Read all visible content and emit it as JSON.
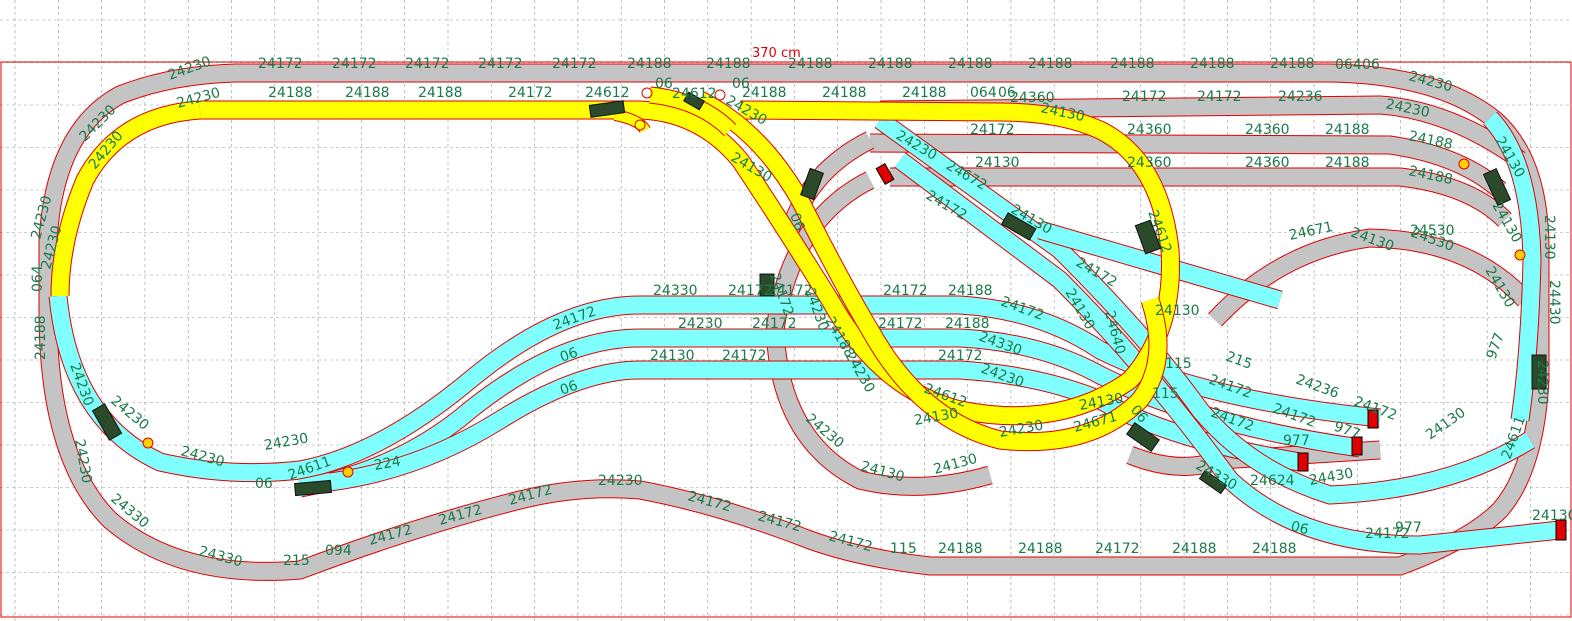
{
  "layout": {
    "board_width_label": "370 cm",
    "colors": {
      "grey_track": "#c4c4c4",
      "cyan_track": "#80ffff",
      "yellow_track": "#ffff00",
      "rail_edge": "#e00000",
      "label": "#1a7a4a",
      "grid": "#9a9a9a",
      "switch_motor": "#2a4a2a"
    },
    "track_labels": [
      {
        "text": "24230",
        "icon": "track-piece"
      },
      {
        "text": "24172"
      },
      {
        "text": "24172"
      },
      {
        "text": "24172"
      },
      {
        "text": "24172"
      },
      {
        "text": "24172"
      },
      {
        "text": "24188"
      },
      {
        "text": "24188"
      },
      {
        "text": "24188"
      },
      {
        "text": "24188"
      },
      {
        "text": "24188"
      },
      {
        "text": "24188"
      },
      {
        "text": "24188"
      },
      {
        "text": "24188"
      },
      {
        "text": "24188"
      },
      {
        "text": "064"
      },
      {
        "text": "06"
      },
      {
        "text": "24230"
      },
      {
        "text": "24230"
      },
      {
        "text": "24188"
      },
      {
        "text": "24188"
      },
      {
        "text": "24188"
      },
      {
        "text": "24172"
      },
      {
        "text": "24612"
      },
      {
        "text": "06"
      },
      {
        "text": "24612"
      },
      {
        "text": "06"
      },
      {
        "text": "24188"
      },
      {
        "text": "24188"
      },
      {
        "text": "24188"
      },
      {
        "text": "064"
      },
      {
        "text": "06"
      },
      {
        "text": "24360"
      },
      {
        "text": "24130"
      },
      {
        "text": "24172"
      },
      {
        "text": "24172"
      },
      {
        "text": "24236"
      },
      {
        "text": "24230"
      },
      {
        "text": "24230"
      },
      {
        "text": "24230"
      },
      {
        "text": "24230"
      },
      {
        "text": "24230"
      },
      {
        "text": "064"
      },
      {
        "text": "24188"
      },
      {
        "text": "24230"
      },
      {
        "text": "24230"
      },
      {
        "text": "24130"
      },
      {
        "text": "24230"
      },
      {
        "text": "24172"
      },
      {
        "text": "24360"
      },
      {
        "text": "24360"
      },
      {
        "text": "24188"
      },
      {
        "text": "24188"
      },
      {
        "text": "24130"
      },
      {
        "text": "24360"
      },
      {
        "text": "24360"
      },
      {
        "text": "24188"
      },
      {
        "text": "24188"
      },
      {
        "text": "24130"
      },
      {
        "text": "24130"
      },
      {
        "text": "24130"
      },
      {
        "text": "24130"
      },
      {
        "text": "24430"
      },
      {
        "text": "24671"
      },
      {
        "text": "24530"
      },
      {
        "text": "24130"
      },
      {
        "text": "24612"
      },
      {
        "text": "24672"
      },
      {
        "text": "24172"
      },
      {
        "text": "24172"
      },
      {
        "text": "24172"
      },
      {
        "text": "24330"
      },
      {
        "text": "24172"
      },
      {
        "text": "24172"
      },
      {
        "text": "24172"
      },
      {
        "text": "24188"
      },
      {
        "text": "06"
      },
      {
        "text": "24230"
      },
      {
        "text": "24172"
      },
      {
        "text": "24172"
      },
      {
        "text": "24188"
      },
      {
        "text": "06"
      },
      {
        "text": "24130"
      },
      {
        "text": "24172"
      },
      {
        "text": "24172"
      },
      {
        "text": "06"
      },
      {
        "text": "24172"
      },
      {
        "text": "24172"
      },
      {
        "text": "24330"
      },
      {
        "text": "24230"
      },
      {
        "text": "24130"
      },
      {
        "text": "24640"
      },
      {
        "text": "24130"
      },
      {
        "text": "115"
      },
      {
        "text": "115"
      },
      {
        "text": "215"
      },
      {
        "text": "24172"
      },
      {
        "text": "24172"
      },
      {
        "text": "24236"
      },
      {
        "text": "24172"
      },
      {
        "text": "24172"
      },
      {
        "text": "977"
      },
      {
        "text": "977"
      },
      {
        "text": "977"
      },
      {
        "text": "24230"
      },
      {
        "text": "24611"
      },
      {
        "text": "24130"
      },
      {
        "text": "24430"
      },
      {
        "text": "24530"
      },
      {
        "text": "24130"
      },
      {
        "text": "24130"
      },
      {
        "text": "977"
      },
      {
        "text": "24172"
      },
      {
        "text": "06"
      },
      {
        "text": "24330"
      },
      {
        "text": "24624"
      },
      {
        "text": "06"
      },
      {
        "text": "24612"
      },
      {
        "text": "24130"
      },
      {
        "text": "24130"
      },
      {
        "text": "24130"
      },
      {
        "text": "24230"
      },
      {
        "text": "24230"
      },
      {
        "text": "24130"
      },
      {
        "text": "24230"
      },
      {
        "text": "24188"
      },
      {
        "text": "24230"
      },
      {
        "text": "24671"
      },
      {
        "text": "24230"
      },
      {
        "text": "24230"
      },
      {
        "text": "24230"
      },
      {
        "text": "24230"
      },
      {
        "text": "06"
      },
      {
        "text": "24611"
      },
      {
        "text": "224"
      },
      {
        "text": "24330"
      },
      {
        "text": "24330"
      },
      {
        "text": "215"
      },
      {
        "text": "094"
      },
      {
        "text": "24172"
      },
      {
        "text": "24172"
      },
      {
        "text": "24172"
      },
      {
        "text": "24230"
      },
      {
        "text": "24172"
      },
      {
        "text": "24172"
      },
      {
        "text": "24172"
      },
      {
        "text": "115"
      },
      {
        "text": "24188"
      },
      {
        "text": "24188"
      },
      {
        "text": "24172"
      },
      {
        "text": "24188"
      },
      {
        "text": "24188"
      }
    ]
  }
}
